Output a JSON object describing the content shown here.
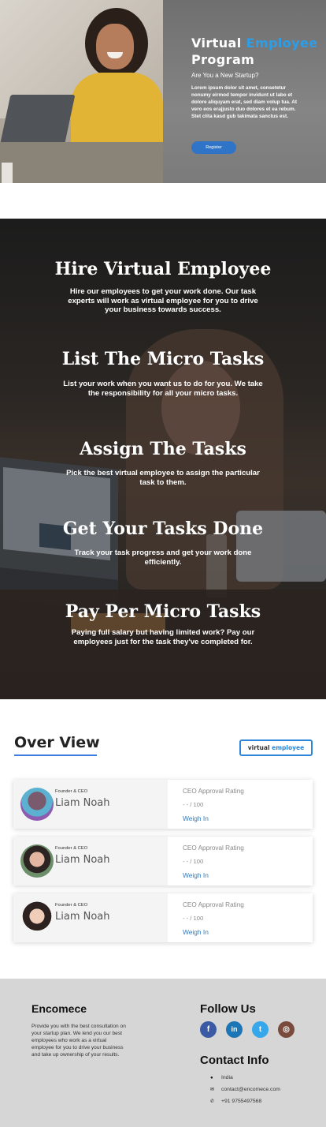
{
  "hero": {
    "title_part1": "Virtual ",
    "title_accent": "Employee",
    "title_part2": "Program",
    "subtitle": "Are You a New Startup?",
    "body": "Lorem ipsum dolor sit amet, consetetur nonumy eirmod tempor invidunt ut labo et dolore aliquyam erat, sed diam volup tua. At vero eos erajjusto duo dolores et ea rebum. Stet clita kasd gub takimata sanctus est.",
    "button_label": "Register"
  },
  "tasks": [
    {
      "title": "Hire Virtual Employee",
      "desc": "Hire our employees to get your work done. Our task experts will work as virtual employee for you to drive your business towards success."
    },
    {
      "title": "List The Micro Tasks",
      "desc": "List your work when you want us to do for you. We take the responsibility for all your micro tasks."
    },
    {
      "title": "Assign The Tasks",
      "desc": "Pick the best virtual employee to assign the particular task to them."
    },
    {
      "title": "Get Your Tasks Done",
      "desc": "Track your task progress and get your work done efficiently."
    },
    {
      "title": "Pay Per Micro Tasks",
      "desc": "Paying full salary but having limited work? Pay our employees just for the task they've completed for."
    }
  ],
  "overview": {
    "heading": "Over View",
    "logo_part1": "virtual ",
    "logo_accent": "employee",
    "cards": [
      {
        "role": "Founder & CEO",
        "name": "Liam Noah",
        "rating_label": "CEO Approval Rating",
        "rating_value": "- - / 100",
        "action": "Weigh In"
      },
      {
        "role": "Founder & CEO",
        "name": "Liam Noah",
        "rating_label": "CEO Approval Rating",
        "rating_value": "- - / 100",
        "action": "Weigh In"
      },
      {
        "role": "Founder & CEO",
        "name": "Liam Noah",
        "rating_label": "CEO Approval Rating",
        "rating_value": "- - / 100",
        "action": "Weigh In"
      }
    ]
  },
  "footer": {
    "brand": "Encomece",
    "description": "Provide you with the best consultation on your startup plan. We lend you our best employees who work as a virtual employee for you to drive your business and take up ownership of your results.",
    "follow_heading": "Follow Us",
    "social": [
      {
        "icon": "facebook-icon",
        "glyph": "f"
      },
      {
        "icon": "linkedin-icon",
        "glyph": "in"
      },
      {
        "icon": "twitter-icon",
        "glyph": "t"
      },
      {
        "icon": "instagram-icon",
        "glyph": "◎"
      }
    ],
    "contact_heading": "Contact Info",
    "contact": [
      {
        "icon": "location-pin-icon",
        "glyph": "●",
        "text": "India"
      },
      {
        "icon": "mail-icon",
        "glyph": "✉",
        "text": "contact@encomece.com"
      },
      {
        "icon": "phone-icon",
        "glyph": "✆",
        "text": "+91 9755497568"
      }
    ]
  },
  "colors": {
    "accent": "#2f9de6",
    "button": "#2f74c7",
    "link": "#2b7cc2",
    "footer_bg": "#d6d6d6"
  }
}
